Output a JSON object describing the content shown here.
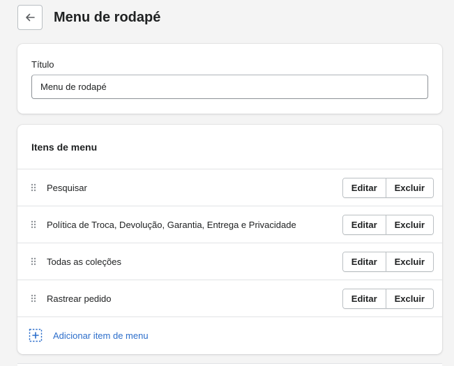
{
  "header": {
    "back_icon": "arrow-left-icon",
    "title": "Menu de rodapé"
  },
  "title_card": {
    "label": "Título",
    "value": "Menu de rodapé"
  },
  "menu_card": {
    "heading": "Itens de menu",
    "items": [
      {
        "label": "Pesquisar",
        "edit": "Editar",
        "delete": "Excluir"
      },
      {
        "label": "Política de Troca, Devolução, Garantia, Entrega e Privacidade",
        "edit": "Editar",
        "delete": "Excluir"
      },
      {
        "label": "Todas as coleções",
        "edit": "Editar",
        "delete": "Excluir"
      },
      {
        "label": "Rastrear pedido",
        "edit": "Editar",
        "delete": "Excluir"
      }
    ],
    "add_label": "Adicionar item de menu",
    "add_icon": "add-item-icon"
  },
  "colors": {
    "link": "#2c6ecb",
    "background": "#f4f4f4",
    "text": "#202223",
    "border": "#babfc3"
  }
}
